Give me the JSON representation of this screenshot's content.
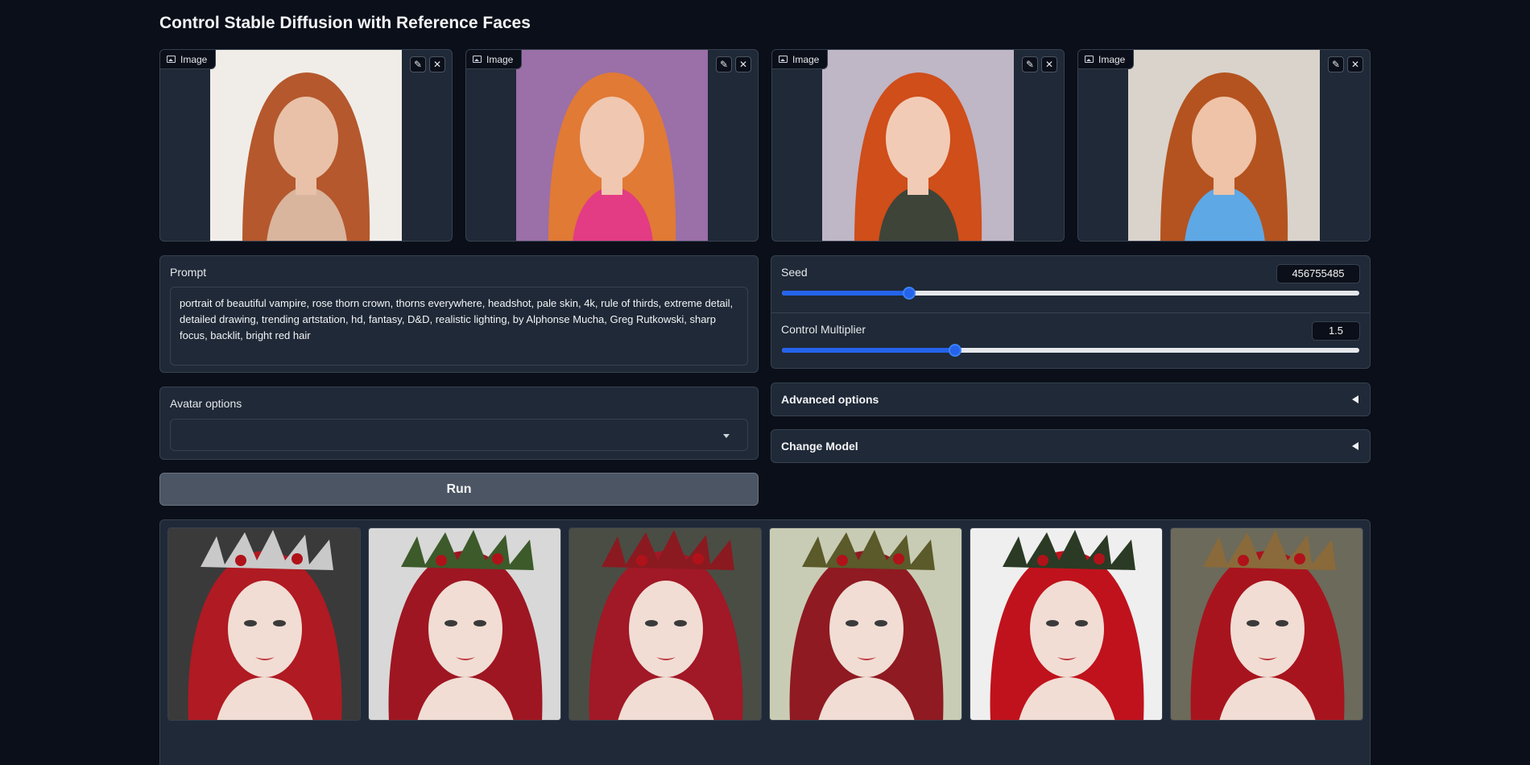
{
  "page": {
    "title": "Control Stable Diffusion with Reference Faces"
  },
  "reference_images": [
    {
      "label": "Image",
      "bg": "#f0ede8",
      "hair": "#b5582d",
      "skin": "#e8c1a8",
      "top": "#d9b59e"
    },
    {
      "label": "Image",
      "bg": "#9b6fa8",
      "hair": "#e07a35",
      "skin": "#f0c7b0",
      "top": "#e33b84"
    },
    {
      "label": "Image",
      "bg": "#bfb6c6",
      "hair": "#cf4e1a",
      "skin": "#f2cbb6",
      "top": "#3e4438"
    },
    {
      "label": "Image",
      "bg": "#d9d3cc",
      "hair": "#b4531f",
      "skin": "#eec3a8",
      "top": "#5ea8e6"
    }
  ],
  "image_buttons": {
    "edit_icon": "pencil-icon",
    "close_icon": "close-icon",
    "edit_glyph": "✎",
    "close_glyph": "✕"
  },
  "prompt": {
    "label": "Prompt",
    "value": "portrait of beautiful vampire, rose thorn crown, thorns everywhere, headshot, pale skin, 4k, rule of thirds, extreme detail, detailed drawing, trending artstation, hd, fantasy, D&D, realistic lighting, by Alphonse Mucha, Greg Rutkowski, sharp focus, backlit, bright red hair"
  },
  "avatar_options": {
    "label": "Avatar options",
    "value": ""
  },
  "run_button": {
    "label": "Run"
  },
  "seed": {
    "label": "Seed",
    "value": "456755485",
    "fraction": 0.22
  },
  "control_multiplier": {
    "label": "Control Multiplier",
    "value": "1.5",
    "fraction": 0.3
  },
  "advanced_options": {
    "label": "Advanced options"
  },
  "change_model": {
    "label": "Change Model"
  },
  "gallery": [
    {
      "bg": "#3a3a3a",
      "hair": "#b01a22",
      "crown": "#c9c9c9"
    },
    {
      "bg": "#d8d8d8",
      "hair": "#9e1622",
      "crown": "#3c5a2a"
    },
    {
      "bg": "#4a4d44",
      "hair": "#a11826",
      "crown": "#8a1a20"
    },
    {
      "bg": "#c9ccb4",
      "hair": "#8f1a22",
      "crown": "#5a5a2a"
    },
    {
      "bg": "#efefef",
      "hair": "#c0121c",
      "crown": "#2a3a24"
    },
    {
      "bg": "#6c6a5a",
      "hair": "#a8141e",
      "crown": "#8a6a3a"
    }
  ],
  "colors": {
    "accent": "#2563eb",
    "panel": "#1f2937",
    "background": "#0b0f19"
  }
}
